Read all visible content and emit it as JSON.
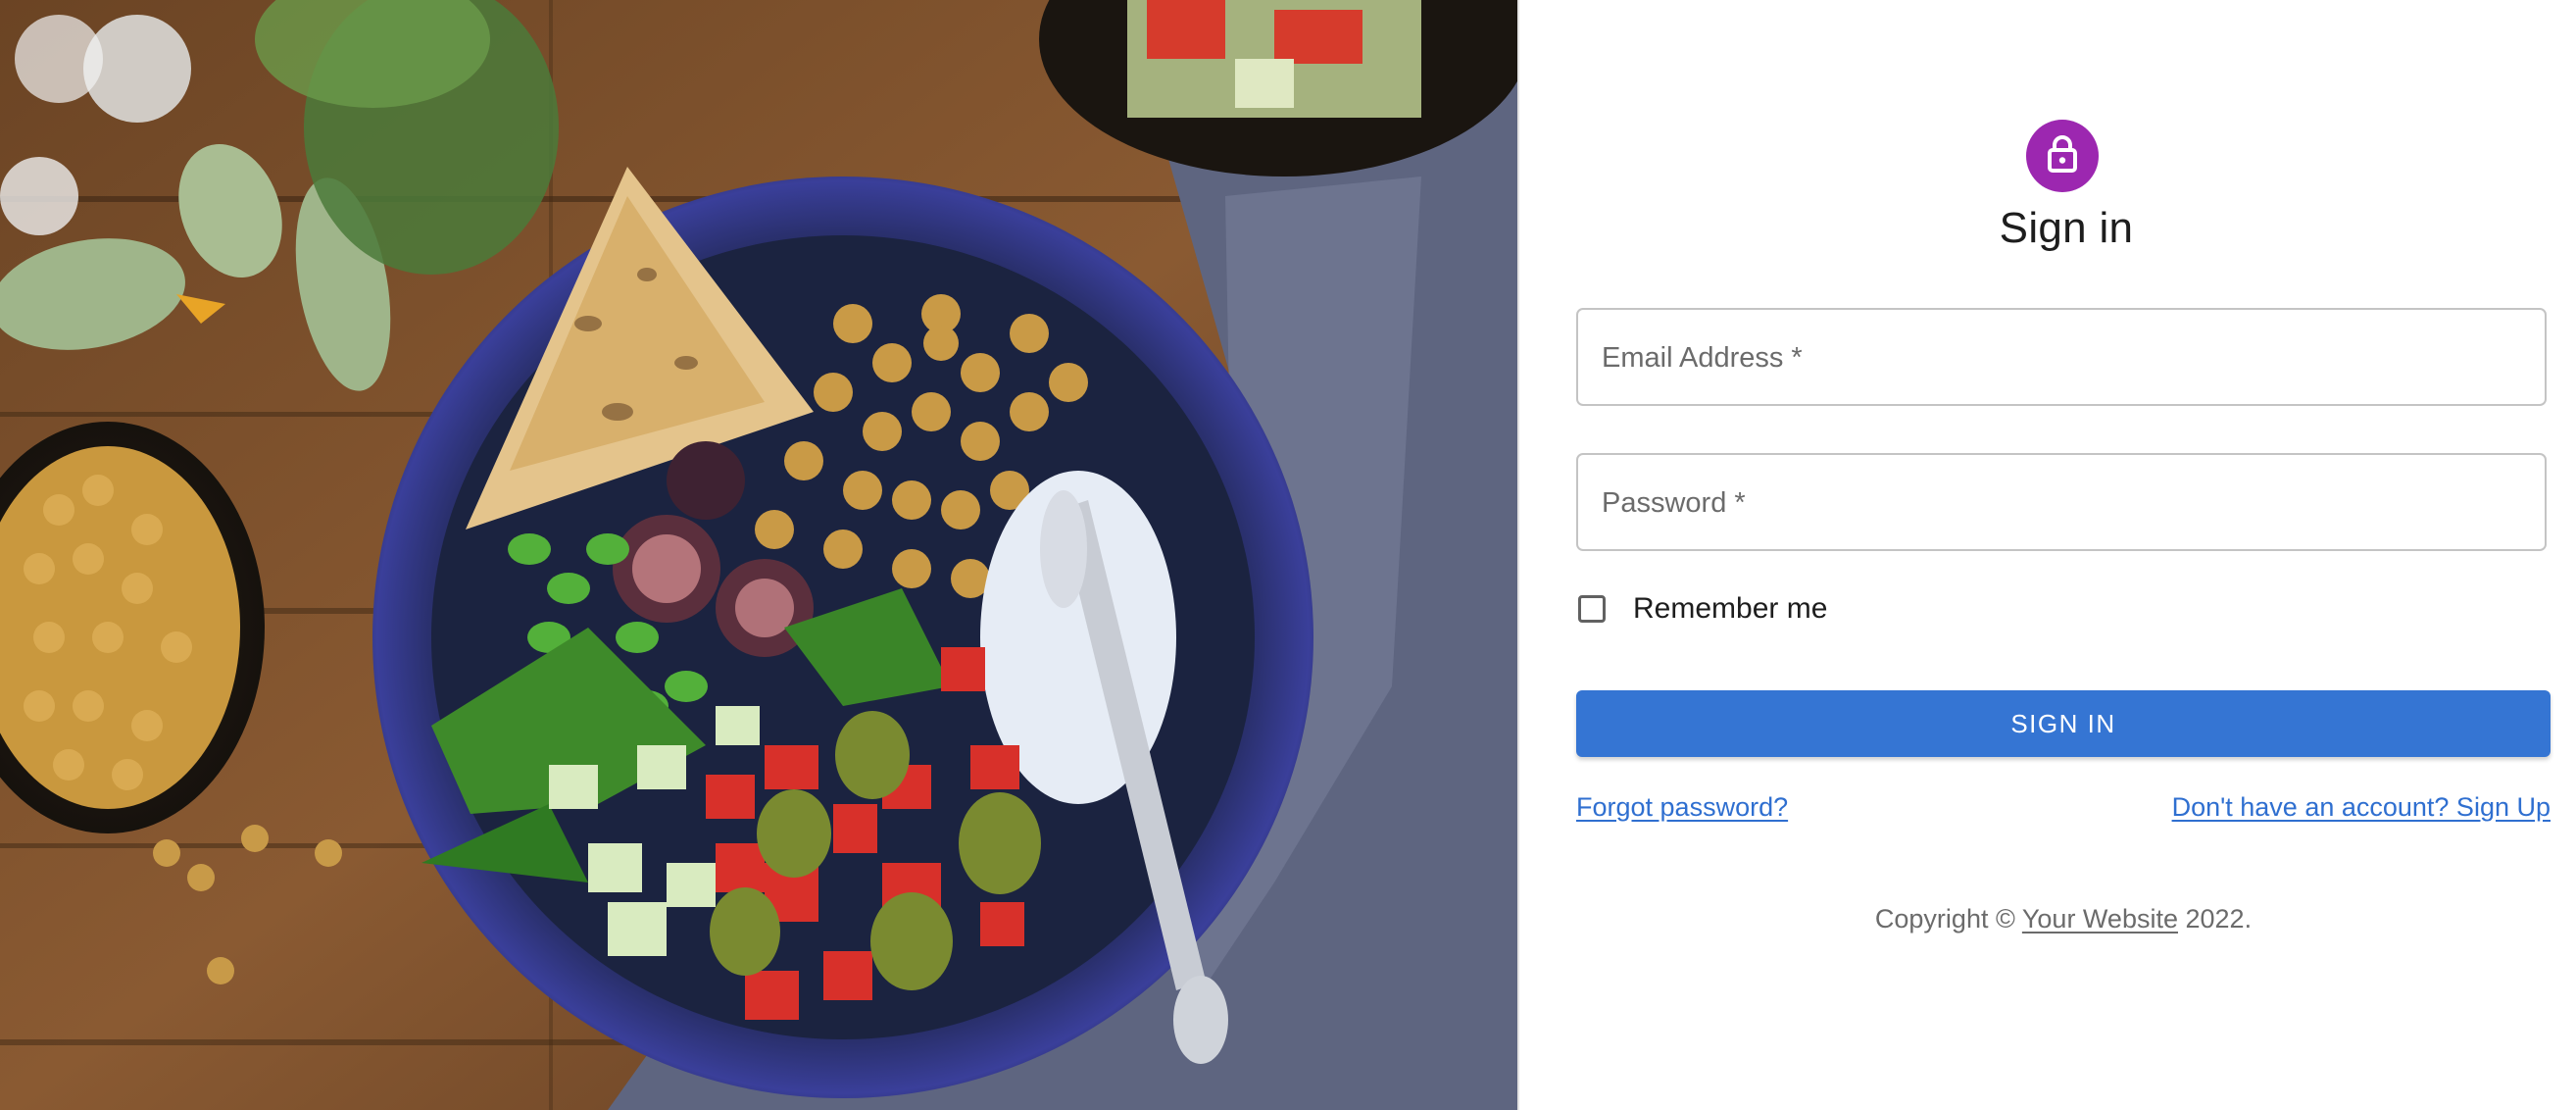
{
  "hero": {
    "image_icon": "food-bowl-photo"
  },
  "form": {
    "lock_icon": "lock-icon",
    "accent_color": "#9c27b0",
    "title": "Sign in",
    "email": {
      "label": "Email Address *",
      "value": ""
    },
    "password": {
      "label": "Password *",
      "value": ""
    },
    "remember": {
      "label": "Remember me",
      "checked": false
    },
    "submit_label": "SIGN IN",
    "submit_color": "#3575d3",
    "forgot_link": "Forgot password?",
    "signup_link": "Don't have an account? Sign Up",
    "copyright": {
      "prefix": "Copyright ©",
      "site": "Your Website",
      "suffix": "2022."
    }
  }
}
